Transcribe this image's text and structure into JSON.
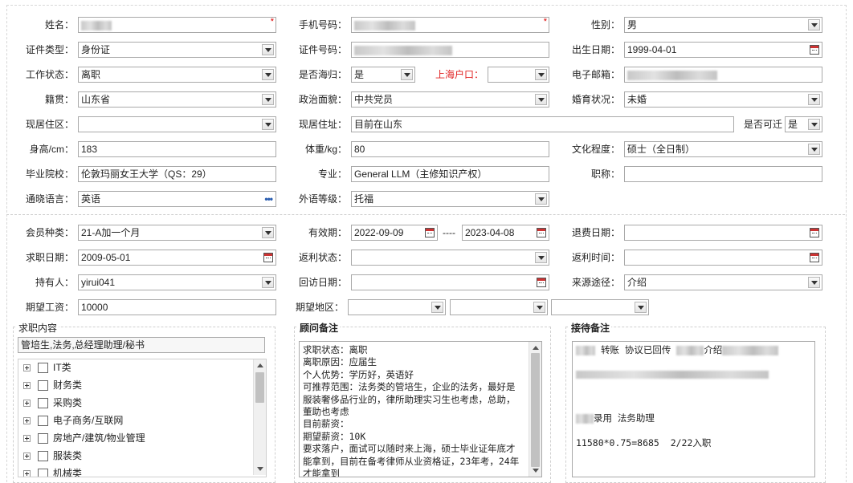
{
  "form": {
    "name": {
      "label": "姓名："
    },
    "mobile": {
      "label": "手机号码："
    },
    "gender": {
      "label": "性别：",
      "value": "男"
    },
    "id_type": {
      "label": "证件类型：",
      "value": "身份证"
    },
    "id_no": {
      "label": "证件号码："
    },
    "birth": {
      "label": "出生日期：",
      "value": "1999-04-01"
    },
    "work_status": {
      "label": "工作状态：",
      "value": "离职"
    },
    "returnee": {
      "label": "是否海归：",
      "value": "是"
    },
    "shanghai_hukou": {
      "label": "上海户口：",
      "value": ""
    },
    "email": {
      "label": "电子邮箱："
    },
    "native": {
      "label": "籍贯：",
      "value": "山东省"
    },
    "political": {
      "label": "政治面貌：",
      "value": "中共党员"
    },
    "marital": {
      "label": "婚育状况：",
      "value": "未婚"
    },
    "district": {
      "label": "现居住区：",
      "value": ""
    },
    "address": {
      "label": "现居住址：",
      "value": "目前在山东"
    },
    "can_move": {
      "label": "是否可迁",
      "value": "是"
    },
    "height": {
      "label": "身高/cm：",
      "value": "183"
    },
    "weight": {
      "label": "体重/kg：",
      "value": "80"
    },
    "education": {
      "label": "文化程度：",
      "value": "硕士（全日制）"
    },
    "school": {
      "label": "毕业院校：",
      "value": "伦敦玛丽女王大学（QS：29）"
    },
    "major": {
      "label": "专业：",
      "value": "General LLM（主修知识产权）"
    },
    "title": {
      "label": "职称：",
      "value": ""
    },
    "language": {
      "label": "通晓语言：",
      "value": "英语",
      "more": "•••"
    },
    "foreign_level": {
      "label": "外语等级：",
      "value": "托福"
    }
  },
  "membership": {
    "type": {
      "label": "会员种类：",
      "value": "21-A加一个月"
    },
    "valid": {
      "label": "有效期：",
      "from": "2022-09-09",
      "sep": "----",
      "to": "2023-04-08"
    },
    "refund_date": {
      "label": "退费日期：",
      "value": ""
    },
    "job_date": {
      "label": "求职日期：",
      "value": "2009-05-01"
    },
    "rebate_status": {
      "label": "返利状态：",
      "value": ""
    },
    "rebate_time": {
      "label": "返利时间：",
      "value": ""
    },
    "holder": {
      "label": "持有人：",
      "value": "yirui041"
    },
    "visit_date": {
      "label": "回访日期：",
      "value": ""
    },
    "source": {
      "label": "来源途径：",
      "value": "介绍"
    },
    "salary": {
      "label": "期望工资：",
      "value": "10000"
    },
    "region": {
      "label": "期望地区：",
      "values": [
        "",
        "",
        ""
      ]
    }
  },
  "job_panel": {
    "title": "求职内容",
    "selected": "管培生,法务,总经理助理/秘书",
    "categories": [
      "IT类",
      "财务类",
      "采购类",
      "电子商务/互联网",
      "房地产/建筑/物业管理",
      "服装类",
      "机械类"
    ]
  },
  "advisor_panel": {
    "title": "顾问备注",
    "text": "求职状态：离职\n离职原因：应届生\n个人优势：学历好，英语好\n可推荐范围：法务类的管培生，企业的法务，最好是服装奢侈品行业的，律所助理实习生也考虑，总助，董助也考虑\n目前薪资：\n期望薪资：10K\n要求落户，面试可以随时来上海，硕士毕业证年底才能拿到，目前在备考律师从业资格证，23年考，24年才能拿到"
  },
  "reception_panel": {
    "title": "接待备注",
    "line1_a": "转账 协议已回传",
    "line1_b": "介绍",
    "line2": "录用 法务助理",
    "line3": "11580*0.75=8685  2/22入职"
  }
}
